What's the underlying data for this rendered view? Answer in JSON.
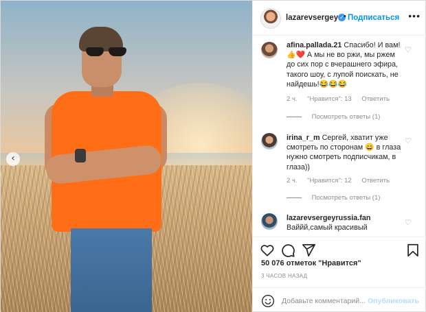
{
  "post": {
    "author": "lazarevsergey",
    "follow_label": "Подписаться",
    "more_glyph": "•••"
  },
  "comments": [
    {
      "user": "afina.pallada.21",
      "text": "Спасибо! И вам! 👍❤️ А мы не во ржи, мы ржем до сих пор с вчерашнего эфира, такого шоу, с лупой поискать, не найдешь!😂😂😂",
      "age": "2 ч.",
      "likes": "\"Нравится\": 13",
      "reply": "Ответить",
      "view_replies": "Посмотреть ответы (1)",
      "avatar_color": "#6b4a3a"
    },
    {
      "user": "irina_r_m",
      "text": "Сергей, хватит уже смотреть по сторонам 😄 в глаза нужно смотреть подписчикам, в глаза))",
      "age": "2 ч.",
      "likes": "\"Нравится\": 12",
      "reply": "Ответить",
      "view_replies": "Посмотреть ответы (1)",
      "avatar_color": "#4a3a32"
    },
    {
      "user": "lazarevsergeyrussia.fan",
      "text": "Ваййй,самый красивый",
      "avatar_color": "#2f4e6a"
    }
  ],
  "footer": {
    "likes_text": "50 076 отметок \"Нравится\"",
    "time_text": "3 ЧАСОВ НАЗАД",
    "comment_placeholder": "Добавьте комментарий...",
    "publish_label": "Опубликовать"
  },
  "icons": {
    "like": "heart-icon",
    "comment": "comment-icon",
    "share": "share-icon",
    "save": "bookmark-icon",
    "emoji": "emoji-icon",
    "verified": "verified-badge-icon",
    "prev": "chevron-left-icon"
  },
  "colors": {
    "accent": "#0095f6",
    "verified": "#3897f0",
    "shirt": "#ff6d17",
    "muted": "#8e8e8e"
  }
}
